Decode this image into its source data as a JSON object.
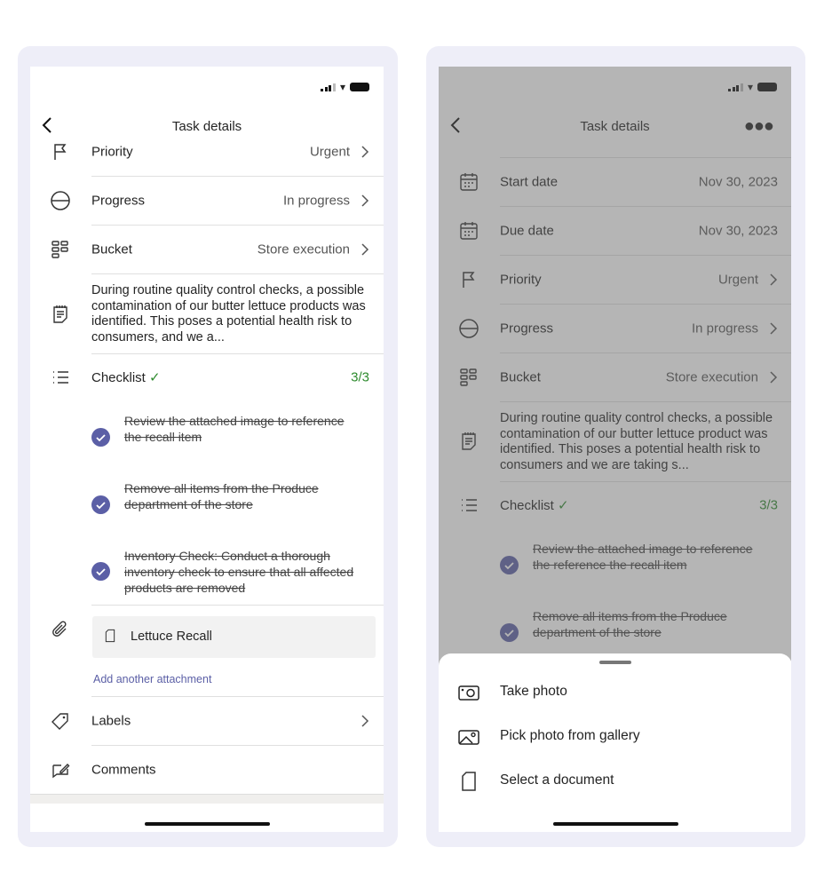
{
  "colors": {
    "accent": "#5b5fa6",
    "success": "#2e8b2e",
    "frame": "#eeeef8",
    "link": "#5b5fa6"
  },
  "left": {
    "title": "Task details",
    "rows": {
      "priority": {
        "label": "Priority",
        "value": "Urgent"
      },
      "progress": {
        "label": "Progress",
        "value": "In progress"
      },
      "bucket": {
        "label": "Bucket",
        "value": "Store execution"
      }
    },
    "description": "During routine quality control checks, a possible contamination of our butter lettuce products was identified. This poses a potential health risk to consumers, and we a...",
    "checklist": {
      "label": "Checklist",
      "count": "3/3",
      "items": [
        "Review the attached image to reference the recall item",
        "Remove all items from the Produce department of the store",
        "Inventory Check: Conduct a thorough inventory check to ensure that all affected products are removed"
      ]
    },
    "attachment": {
      "name": "Lettuce Recall",
      "add_link": "Add another attachment"
    },
    "labels": "Labels",
    "comments": "Comments"
  },
  "right": {
    "title": "Task details",
    "rows": {
      "start": {
        "label": "Start date",
        "value": "Nov 30, 2023"
      },
      "due": {
        "label": "Due date",
        "value": "Nov 30, 2023"
      },
      "priority": {
        "label": "Priority",
        "value": "Urgent"
      },
      "progress": {
        "label": "Progress",
        "value": "In progress"
      },
      "bucket": {
        "label": "Bucket",
        "value": "Store execution"
      }
    },
    "description": "During routine quality control checks, a possible contamination of our butter lettuce product was identified. This poses a potential health risk to consumers and we are taking s...",
    "checklist": {
      "label": "Checklist",
      "count": "3/3",
      "items": [
        "Review the attached image to reference the reference the recall item",
        "Remove all items from the Produce department of the store"
      ]
    },
    "sheet": {
      "items": [
        "Take photo",
        "Pick photo from gallery",
        "Select a document"
      ]
    }
  }
}
